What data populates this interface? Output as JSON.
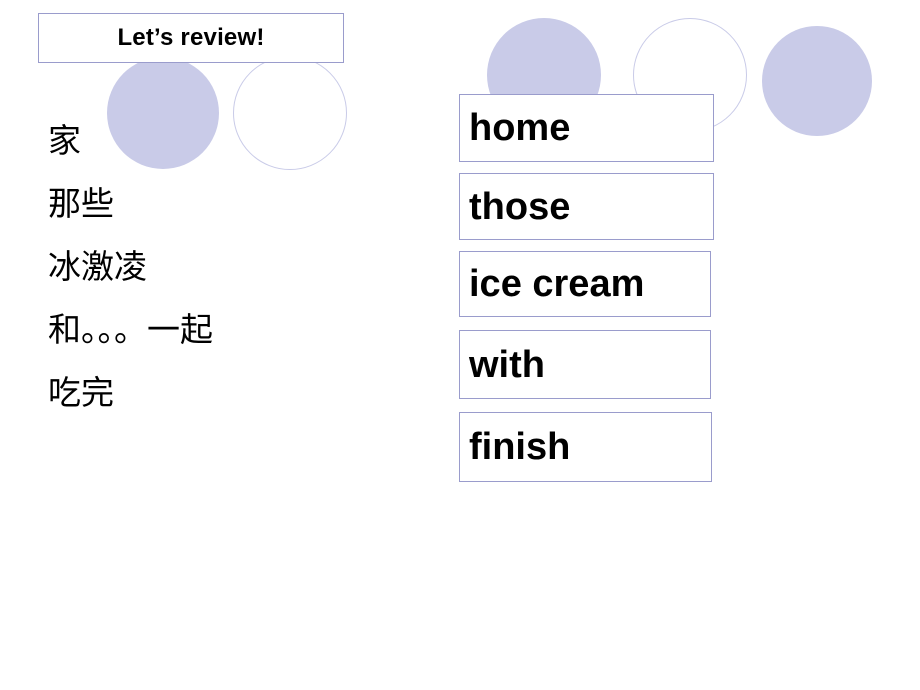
{
  "slide": {
    "title": "Let’s review!",
    "background_color": "#ffffff",
    "accent_color": "#c9cbe8",
    "border_color": "#9a9ccc",
    "chinese_terms": [
      "家",
      "那些",
      "冰激凌",
      "和。。。一起",
      "吃完"
    ],
    "english_terms": [
      "home",
      "those",
      "ice cream",
      "with",
      "finish"
    ]
  }
}
